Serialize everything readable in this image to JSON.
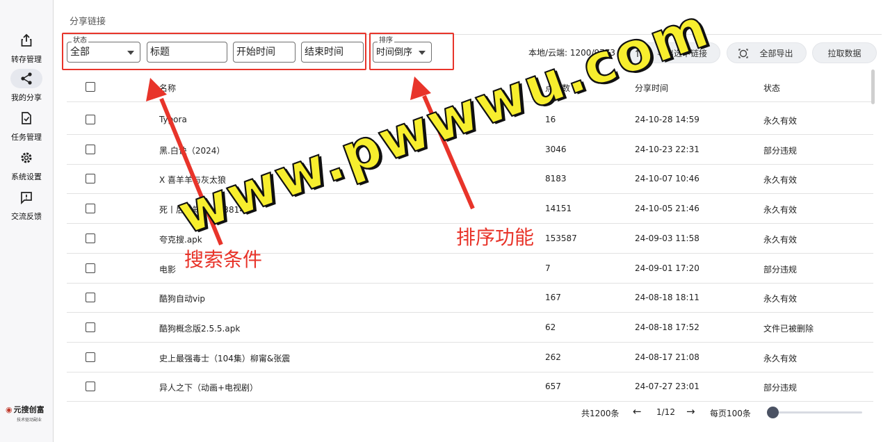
{
  "sidebar": {
    "items": [
      {
        "label": "转存管理",
        "icon": "share-upload-icon"
      },
      {
        "label": "我的分享",
        "icon": "share-nodes-icon",
        "active": true
      },
      {
        "label": "任务管理",
        "icon": "task-check-icon"
      },
      {
        "label": "系统设置",
        "icon": "gear-icon"
      },
      {
        "label": "交流反馈",
        "icon": "feedback-icon"
      }
    ],
    "logo": {
      "title": "元搜创富",
      "subtitle": "技术驱动副业"
    }
  },
  "page": {
    "title": "分享链接"
  },
  "filters": {
    "status": {
      "legend": "状态",
      "value": "全部"
    },
    "title_placeholder": "标题",
    "start_placeholder": "开始时间",
    "end_placeholder": "结束时间",
    "sort": {
      "legend": "排序",
      "value": "时间倒序"
    }
  },
  "toolbar": {
    "count_text": "本地/云端: 1200/9773",
    "export_selected": "导出选中链接",
    "export_all": "全部导出",
    "fetch": "拉取数据"
  },
  "table": {
    "headers": [
      "名称",
      "点击数",
      "分享时间",
      "状态"
    ],
    "rows": [
      {
        "name": "Typora",
        "clicks": "16",
        "time": "24-10-28 14:59",
        "status": "永久有效"
      },
      {
        "name": "黑.白诀（2024）",
        "clicks": "3046",
        "time": "24-10-23 22:31",
        "status": "部分违规"
      },
      {
        "name": "X 喜羊羊与灰太狼",
        "clicks": "8183",
        "time": "24-10-07 10:46",
        "status": "永久有效"
      },
      {
        "name": "死丨后才知ID：73814",
        "clicks": "14151",
        "time": "24-10-05 21:46",
        "status": "永久有效"
      },
      {
        "name": "夸克搜.apk",
        "clicks": "153587",
        "time": "24-09-03 11:58",
        "status": "永久有效"
      },
      {
        "name": "电影",
        "clicks": "7",
        "time": "24-09-01 17:20",
        "status": "部分违规"
      },
      {
        "name": "酷狗自动vip",
        "clicks": "167",
        "time": "24-08-18 18:11",
        "status": "永久有效"
      },
      {
        "name": "酷狗概念版2.5.5.apk",
        "clicks": "62",
        "time": "24-08-18 17:52",
        "status": "文件已被删除"
      },
      {
        "name": "史上最强毒士（104集）柳甯&张震",
        "clicks": "262",
        "time": "24-08-17 21:08",
        "status": "永久有效"
      },
      {
        "name": "异人之下（动画+电视剧）",
        "clicks": "657",
        "time": "24-07-27 23:01",
        "status": "部分违规"
      }
    ]
  },
  "pagination": {
    "total": "共1200条",
    "page": "1/12",
    "per_page": "每页100条",
    "slider_level": 0
  },
  "annotations": {
    "search": "搜索条件",
    "sort": "排序功能",
    "watermark": "www.pwwwu.com"
  },
  "colors": {
    "annotation": "#e8342a",
    "watermark": "#f7ee2e",
    "slider_knob": "#4b5263"
  }
}
